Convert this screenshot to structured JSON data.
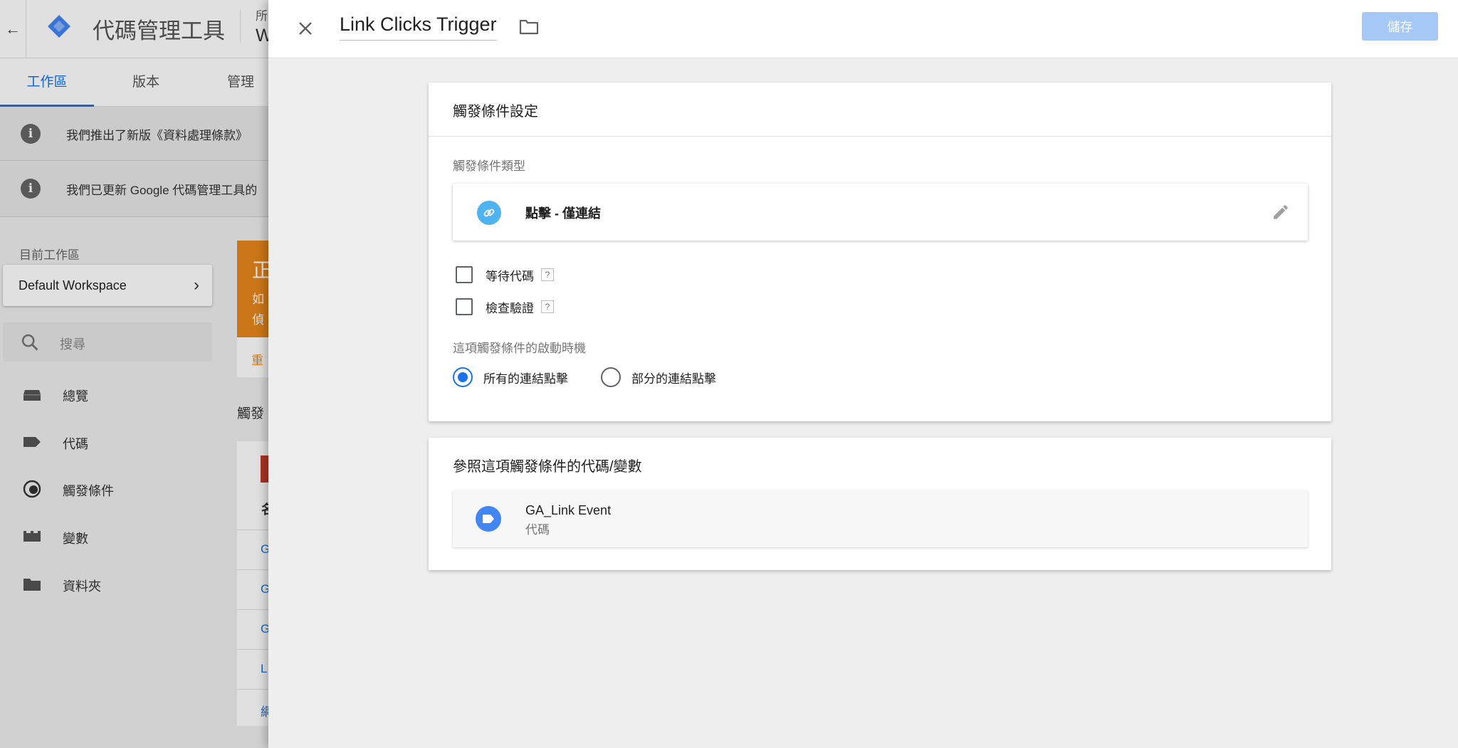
{
  "app": {
    "title": "代碼管理工具",
    "account_label": "所",
    "container_name": "W"
  },
  "nav_tabs": [
    {
      "label": "工作區",
      "active": true
    },
    {
      "label": "版本",
      "active": false
    },
    {
      "label": "管理",
      "active": false
    }
  ],
  "notices": [
    {
      "text": "我們推出了新版《資料處理條款》"
    },
    {
      "text": "我們已更新 Google 代碼管理工具的"
    }
  ],
  "sidebar": {
    "current_workspace_label": "目前工作區",
    "workspace_name": "Default Workspace",
    "search_placeholder": "搜尋",
    "items": [
      {
        "label": "總覽",
        "icon": "briefcase-icon",
        "active": false
      },
      {
        "label": "代碼",
        "icon": "tag-icon",
        "active": false
      },
      {
        "label": "觸發條件",
        "icon": "trigger-icon",
        "active": true
      },
      {
        "label": "變數",
        "icon": "variable-icon",
        "active": false
      },
      {
        "label": "資料夾",
        "icon": "folder-icon",
        "active": false
      }
    ]
  },
  "background_content": {
    "orange_title": "正",
    "orange_line1": "如",
    "orange_line2": "偵",
    "orange_link": "重",
    "list_heading": "觸發",
    "column_header": "名",
    "rows": [
      "G",
      "G",
      "G",
      "L",
      "網"
    ]
  },
  "editor": {
    "title": "Link Clicks Trigger",
    "save_label": "儲存",
    "config_card": {
      "title": "觸發條件設定",
      "type_label_heading": "觸發條件類型",
      "trigger_type": "點擊 - 僅連結",
      "checkboxes": [
        {
          "label": "等待代碼",
          "checked": false,
          "help": "?"
        },
        {
          "label": "檢查驗證",
          "checked": false,
          "help": "?"
        }
      ],
      "fire_on_label": "這項觸發條件的啟動時機",
      "fire_options": [
        {
          "label": "所有的連結點擊",
          "selected": true
        },
        {
          "label": "部分的連結點擊",
          "selected": false
        }
      ]
    },
    "references_card": {
      "title": "參照這項觸發條件的代碼/變數",
      "items": [
        {
          "name": "GA_Link Event",
          "type": "代碼"
        }
      ]
    }
  },
  "colors": {
    "accent": "#1a73e8",
    "save_disabled": "#a6c8f7",
    "link_icon_bg": "#4fb3f2",
    "tag_icon_bg": "#4285f4",
    "warning_orange": "#e6861b"
  }
}
